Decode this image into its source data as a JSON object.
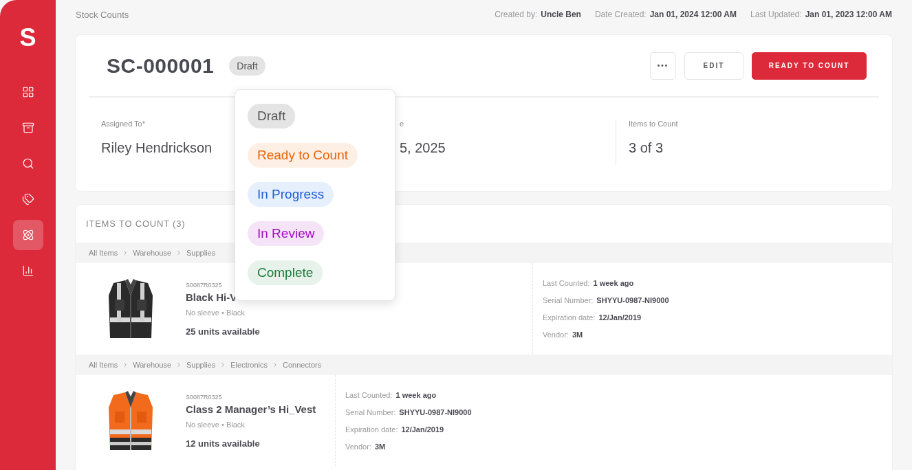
{
  "sidebar": {
    "logo": "S",
    "items": [
      {
        "kind": "grid",
        "selected": false
      },
      {
        "kind": "box",
        "selected": false
      },
      {
        "kind": "search",
        "selected": false
      },
      {
        "kind": "tags",
        "selected": false
      },
      {
        "kind": "atom",
        "selected": true
      },
      {
        "kind": "chart",
        "selected": false
      }
    ]
  },
  "header": {
    "breadcrumb": "Stock Counts",
    "meta": [
      {
        "label": "Created by:",
        "value": "Uncle Ben"
      },
      {
        "label": "Date Created:",
        "value": "Jan 01, 2024 12:00 AM"
      },
      {
        "label": "Last Updated:",
        "value": "Jan 01, 2023 12:00 AM"
      }
    ]
  },
  "stock_count": {
    "id": "SC-000001",
    "status": {
      "label": "Draft",
      "kind": "draft"
    },
    "buttons": {
      "more": "•••",
      "edit": "EDIT",
      "primary": "READY TO COUNT"
    },
    "fields": [
      {
        "label": "Assigned To*",
        "value": "Riley Hendrickson"
      },
      {
        "label": "e",
        "value": "5, 2025"
      },
      {
        "label": "Items to Count",
        "value": "3 of 3"
      }
    ]
  },
  "status_menu": [
    {
      "label": "Draft",
      "kind": "draft"
    },
    {
      "label": "Ready to Count",
      "kind": "ready"
    },
    {
      "label": "In Progress",
      "kind": "progress"
    },
    {
      "label": "In Review",
      "kind": "review"
    },
    {
      "label": "Complete",
      "kind": "complete"
    }
  ],
  "items_section": {
    "title": "ITEMS TO COUNT (3)",
    "items": [
      {
        "breadcrumb": [
          "All Items",
          "Warehouse",
          "Supplies"
        ],
        "picture": {
          "kind": "picture"
        },
        "sku": "S0087R0325",
        "name": "Black Hi-V",
        "variant": "No sleeve • Black",
        "units": "25 units available",
        "details": [
          {
            "label": "Last Counted:",
            "value": "1 week ago"
          },
          {
            "label": "Serial Number:",
            "value": "SHYYU-0987-NI9000"
          },
          {
            "label": "Expiration date:",
            "value": "12/Jan/2019"
          },
          {
            "label": "Vendor:",
            "value": "3M"
          }
        ]
      },
      {
        "breadcrumb": [
          "All Items",
          "Warehouse",
          "Supplies",
          "Electronics",
          "Connectors"
        ],
        "picture": {
          "kind": "picture"
        },
        "sku": "S0087R0325",
        "name": "Class 2 Manager’s Hi_Vest",
        "variant": "No sleeve • Black",
        "units": "12 units available",
        "details": [
          {
            "label": "Last Counted:",
            "value": "1 week ago"
          },
          {
            "label": "Serial Number:",
            "value": "SHYYU-0987-NI9000"
          },
          {
            "label": "Expiration date:",
            "value": "12/Jan/2019"
          },
          {
            "label": "Vendor:",
            "value": "3M"
          }
        ]
      }
    ]
  }
}
